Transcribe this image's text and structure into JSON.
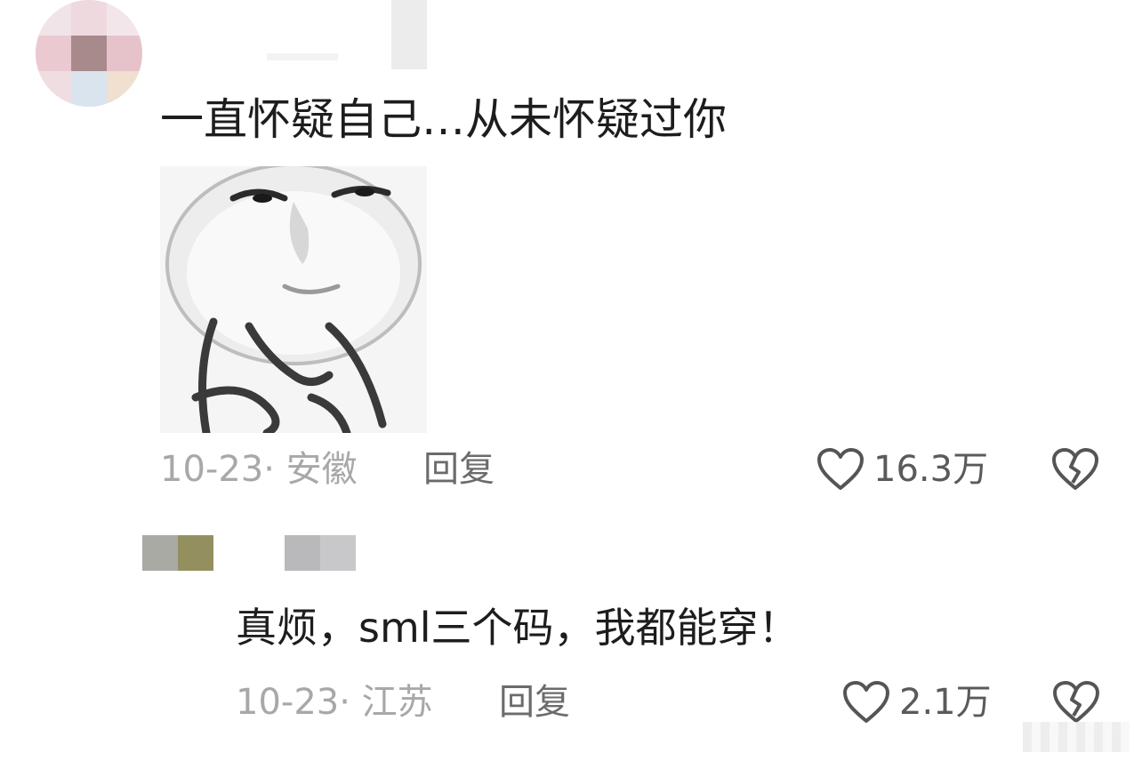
{
  "comments": [
    {
      "text": "一直怀疑自己…从未怀疑过你",
      "date_location": "10-23· 安徽",
      "reply_label": "回复",
      "like_count": "16.3万",
      "has_sticker": true,
      "sticker_icon": "meme-sticker-face"
    },
    {
      "text": "真烦，sml三个码，我都能穿！",
      "date_location": "10-23· 江苏",
      "reply_label": "回复",
      "like_count": "2.1万",
      "has_sticker": false
    }
  ],
  "icons": {
    "like": "heart-outline-icon",
    "dislike": "broken-heart-icon"
  },
  "colors": {
    "meta_text": "#a8a8a8",
    "reply_text": "#6b6b6b",
    "body_text": "#1d1d1d"
  }
}
